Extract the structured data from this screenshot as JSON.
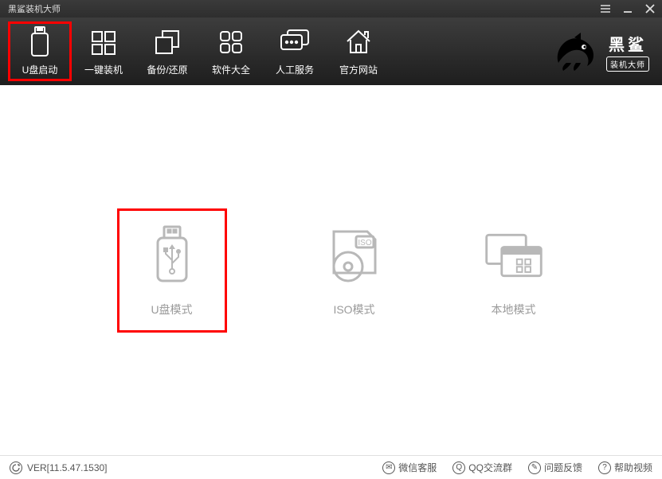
{
  "titlebar": {
    "title": "黑鲨装机大师"
  },
  "nav": {
    "items": [
      {
        "label": "U盘启动"
      },
      {
        "label": "一键装机"
      },
      {
        "label": "备份/还原"
      },
      {
        "label": "软件大全"
      },
      {
        "label": "人工服务"
      },
      {
        "label": "官方网站"
      }
    ]
  },
  "logo": {
    "line1": "黑鲨",
    "line2": "装机大师"
  },
  "modes": {
    "usb": "U盘模式",
    "iso": "ISO模式",
    "local": "本地模式"
  },
  "statusbar": {
    "version": "VER[11.5.47.1530]",
    "links": {
      "wechat": "微信客服",
      "qq": "QQ交流群",
      "feedback": "问题反馈",
      "help": "帮助视频"
    }
  }
}
